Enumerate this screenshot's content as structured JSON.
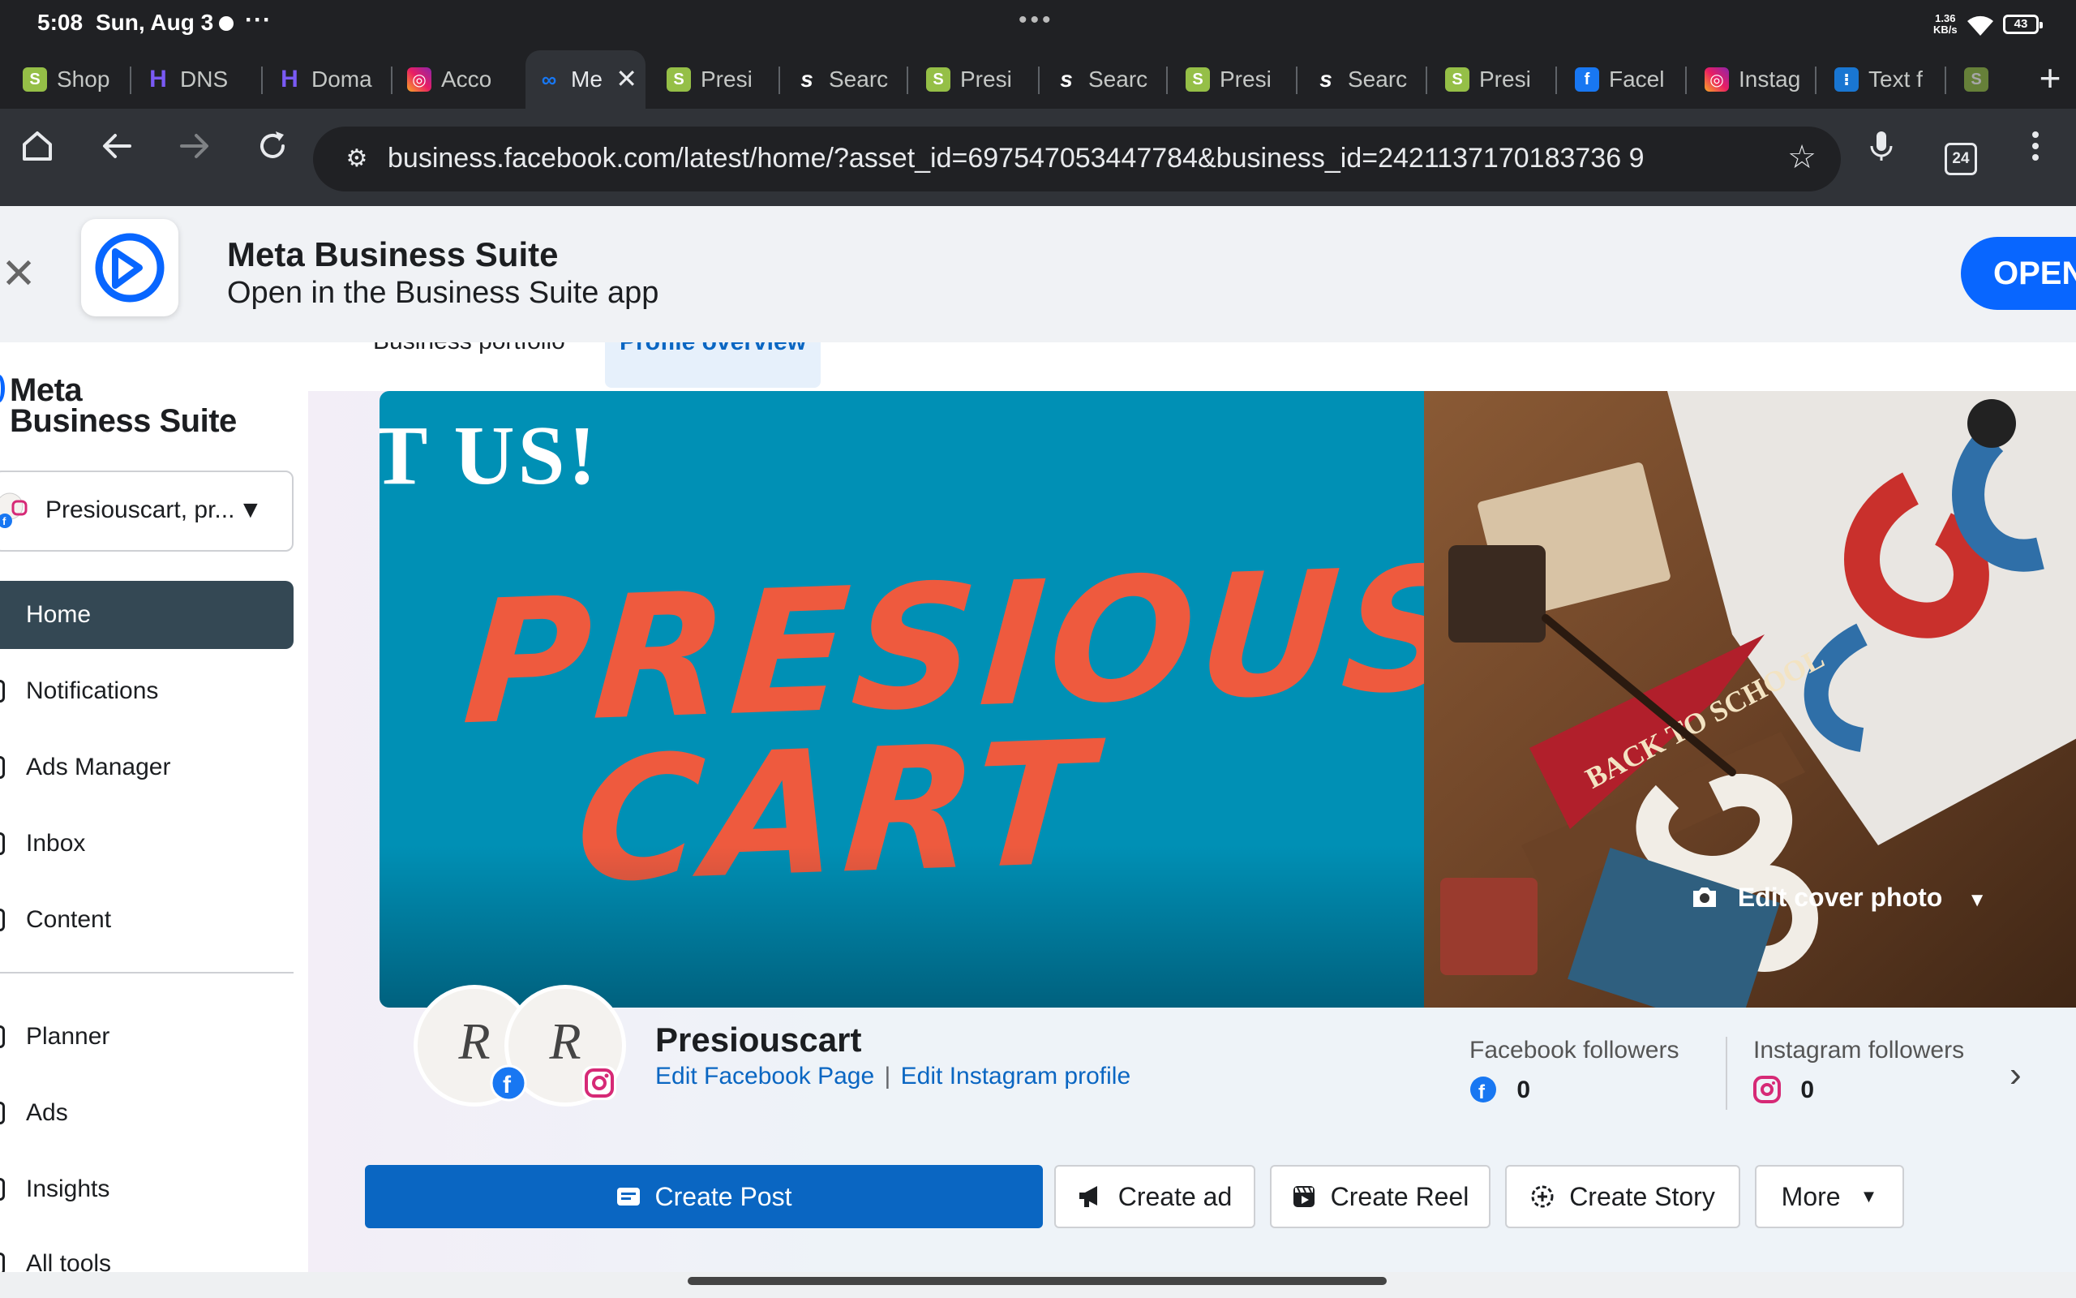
{
  "status_bar": {
    "time": "5:08",
    "date": "Sun, Aug 3",
    "more": "···",
    "window_dots": "•••",
    "net_speed_value": "1.36",
    "net_speed_unit": "KB/s",
    "battery": "43"
  },
  "tabs": [
    {
      "label": "Shop",
      "favicon": "shopify-icon"
    },
    {
      "label": "DNS",
      "favicon": "dns-icon"
    },
    {
      "label": "Doma",
      "favicon": "dns-icon"
    },
    {
      "label": "Acco",
      "favicon": "instagram-icon"
    },
    {
      "label": "Me",
      "favicon": "meta-icon",
      "active": true
    },
    {
      "label": "Presi",
      "favicon": "shopify-icon"
    },
    {
      "label": "Searc",
      "favicon": "s-icon"
    },
    {
      "label": "Presi",
      "favicon": "shopify-icon"
    },
    {
      "label": "Searc",
      "favicon": "s-icon"
    },
    {
      "label": "Presi",
      "favicon": "shopify-icon"
    },
    {
      "label": "Searc",
      "favicon": "s-icon"
    },
    {
      "label": "Presi",
      "favicon": "shopify-icon"
    },
    {
      "label": "Facel",
      "favicon": "facebook-icon"
    },
    {
      "label": "Instag",
      "favicon": "instagram-icon"
    },
    {
      "label": "Text f",
      "favicon": "text-icon"
    }
  ],
  "toolbar": {
    "url": "business.facebook.com/latest/home/?asset_id=697547053447784&business_id=2421137170183736 9",
    "tab_count": "24"
  },
  "app_banner": {
    "title": "Meta Business Suite",
    "subtitle": "Open in the Business Suite app",
    "open_label": "OPEN"
  },
  "sidebar": {
    "logo_line1": "Meta",
    "logo_line2": "Business Suite",
    "account_name": "Presiouscart, pr...",
    "items": [
      {
        "label": "Home",
        "active": true
      },
      {
        "label": "Notifications"
      },
      {
        "label": "Ads Manager"
      },
      {
        "label": "Inbox"
      },
      {
        "label": "Content"
      },
      {
        "label": "Planner"
      },
      {
        "label": "Ads"
      },
      {
        "label": "Insights"
      },
      {
        "label": "All tools"
      }
    ]
  },
  "main": {
    "tabs": {
      "business_portfolio": "Business portfolio",
      "profile_overview": "Profile overview"
    },
    "cover": {
      "us_text": "T US!",
      "brand_line1": "PRESIOUS",
      "brand_line2": "CART",
      "edit_label": "Edit cover photo"
    },
    "profile": {
      "name": "Presiouscart",
      "edit_facebook": "Edit Facebook Page",
      "separator": "|",
      "edit_instagram": "Edit Instagram profile",
      "avatar_monogram": "R"
    },
    "followers": {
      "facebook_label": "Facebook followers",
      "facebook_count": "0",
      "instagram_label": "Instagram followers",
      "instagram_count": "0"
    },
    "actions": {
      "create_post": "Create Post",
      "create_ad": "Create ad",
      "create_reel": "Create Reel",
      "create_story": "Create Story",
      "more": "More"
    }
  },
  "colors": {
    "primary_blue": "#0a66c2",
    "meta_blue": "#0866ff",
    "nav_active": "#344854",
    "cover_teal": "#0090b5",
    "cover_red": "#ee5a3e"
  }
}
